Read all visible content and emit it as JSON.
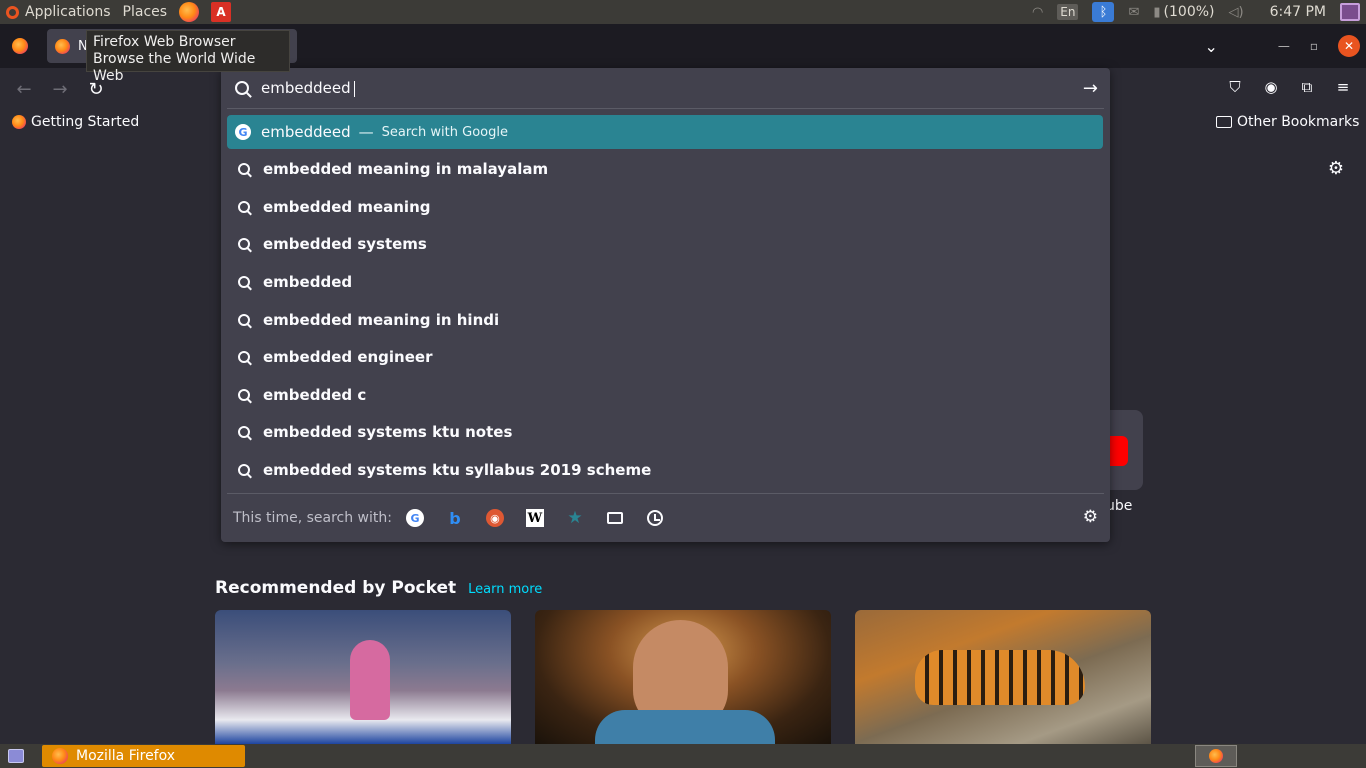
{
  "system_panel": {
    "applications": "Applications",
    "places": "Places",
    "lang": "En",
    "battery": "(100%)",
    "time": "6:47 PM"
  },
  "browser": {
    "tab_title": "N",
    "tooltip_line1": "Firefox Web Browser",
    "tooltip_line2": "Browse the World Wide Web"
  },
  "urlbar": {
    "value": "embeddeed"
  },
  "suggestions": {
    "first": {
      "text": "embeddeed",
      "separator": "—",
      "action": "Search with Google"
    },
    "items": [
      "embedded meaning in malayalam",
      "embedded meaning",
      "embedded systems",
      "embedded",
      "embedded meaning in hindi",
      "embedded engineer",
      "embedded c",
      "embedded systems ktu notes",
      "embedded systems ktu syllabus 2019 scheme"
    ]
  },
  "one_off": {
    "label": "This time, search with:",
    "google": "G",
    "bing": "b",
    "wiki": "W"
  },
  "bookmarks": {
    "getting_started": "Getting Started",
    "other": "Other Bookmarks"
  },
  "newtab": {
    "shortcut_label": "ube",
    "pocket_title": "Recommended by Pocket",
    "pocket_learn": "Learn more"
  },
  "taskbar": {
    "window": "Mozilla Firefox"
  }
}
